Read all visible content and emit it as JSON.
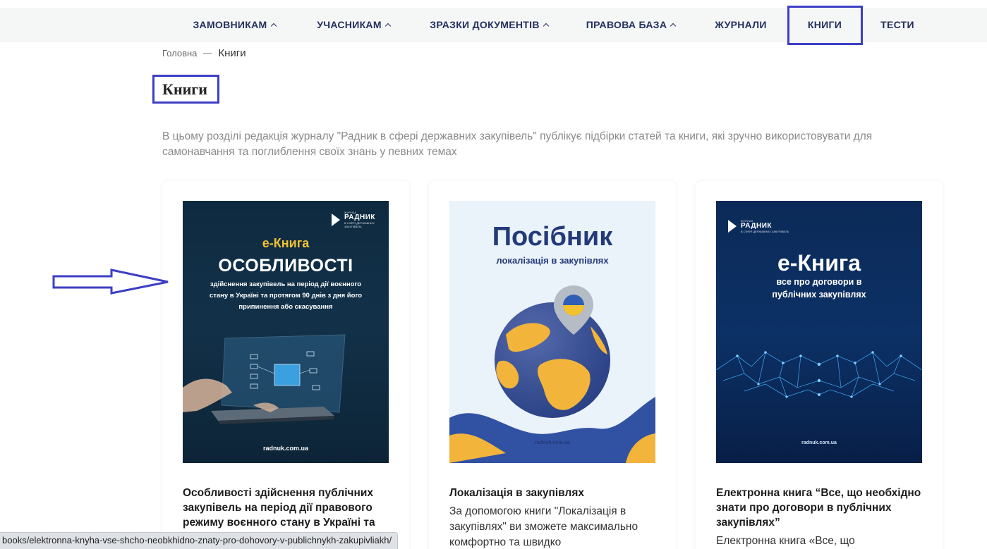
{
  "nav": {
    "items": [
      {
        "label": "ЗАМОВНИКАМ",
        "has_dropdown": true
      },
      {
        "label": "УЧАСНИКАМ",
        "has_dropdown": true
      },
      {
        "label": "ЗРАЗКИ ДОКУМЕНТІВ",
        "has_dropdown": true
      },
      {
        "label": "ПРАВОВА БАЗА",
        "has_dropdown": true
      },
      {
        "label": "ЖУРНАЛИ",
        "has_dropdown": false
      },
      {
        "label": "КНИГИ",
        "has_dropdown": false,
        "active": true
      },
      {
        "label": "ТЕСТИ",
        "has_dropdown": false
      }
    ]
  },
  "breadcrumb": {
    "home": "Головна",
    "current": "Книги"
  },
  "page": {
    "title": "Книги",
    "description": "В цьому розділі редакція журналу \"Радник в сфері державних закупівель\" публікує підбірки статей та книги, які зручно використовувати для самонавчання та поглиблення своїх знань у певних темах"
  },
  "cards": [
    {
      "cover": {
        "logo_title": "РАДНИК",
        "logo_small": "ЖУРНАЛ",
        "logo_sub": "В СФЕРІ ДЕРЖАВНИХ ЗАКУПІВЕЛЬ",
        "kicker": "е-Книга",
        "heading": "ОСОБЛИВОСТІ",
        "subtitle": "здійснення закупівель на період дії воєнного стану в Україні та протягом 90 днів з дня його припинення або скасування",
        "url": "radnuk.com.ua"
      },
      "title": "Особливості здійснення публічних закупівель на період дії правового режиму воєнного стану в Україні та",
      "text": ""
    },
    {
      "cover": {
        "heading": "Посібник",
        "subtitle": "локалізація в закупівлях",
        "url": "radnuk.com.ua"
      },
      "title": "Локалізація в закупівлях",
      "text": "За допомогою книги \"Локалізація в закупівлях\" ви зможете максимально комфортно та швидко"
    },
    {
      "cover": {
        "logo_title": "РАДНИК",
        "logo_small": "ЖУРНАЛ",
        "logo_sub": "В СФЕРІ ДЕРЖАВНИХ ЗАКУПІВЕЛЬ",
        "heading": "е-Книга",
        "subtitle": "все про договори в публічних закупівлях",
        "url": "radnuk.com.ua"
      },
      "title": "Електронна книга “Все, що необхідно знати про договори в публічних закупівлях”",
      "text": "Електронна книга «Все, що"
    }
  ],
  "status_bar": {
    "url": "books/elektronna-knyha-vse-shcho-neobkhidno-znaty-pro-dohovory-v-publichnykh-zakupivliakh/"
  },
  "colors": {
    "nav_text": "#23305f",
    "highlight": "#3c3fc4",
    "cover_accent": "#f1c232"
  }
}
